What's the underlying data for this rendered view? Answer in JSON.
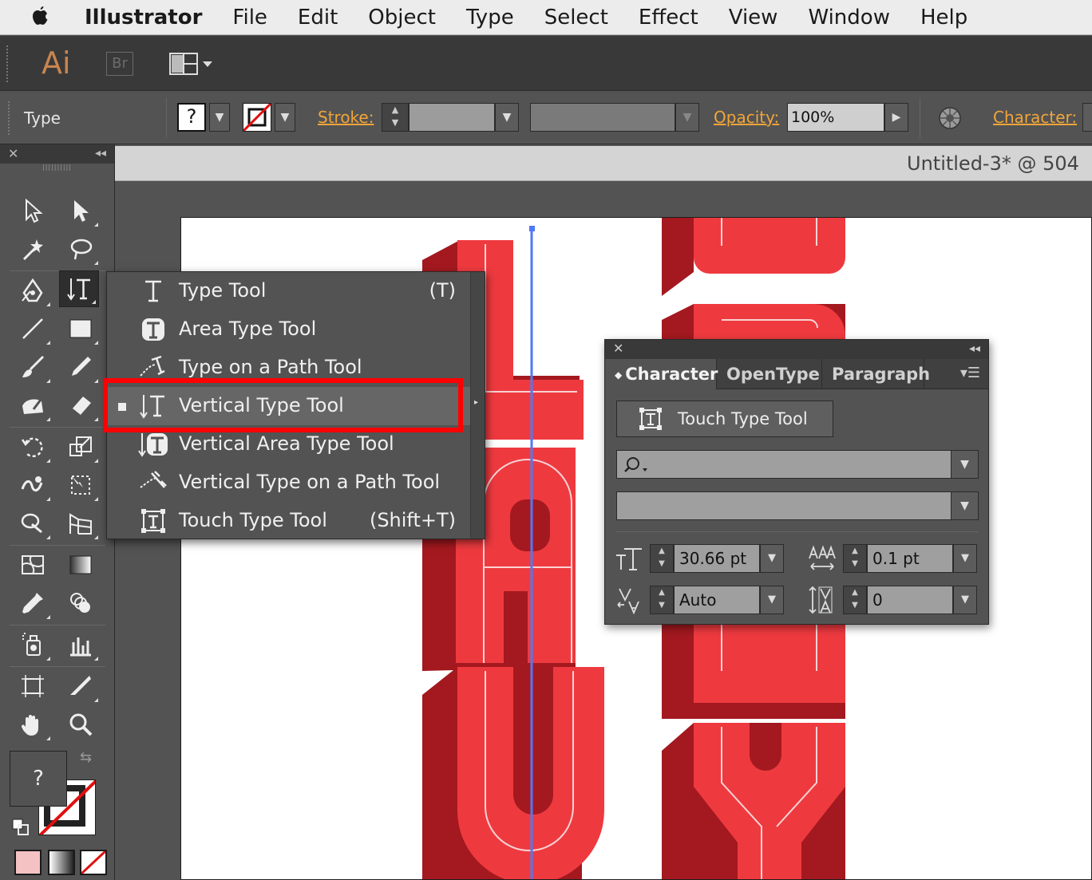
{
  "menubar": {
    "app_name": "Illustrator",
    "items": [
      "File",
      "Edit",
      "Object",
      "Type",
      "Select",
      "Effect",
      "View",
      "Window",
      "Help"
    ]
  },
  "appbar": {
    "logo": "Ai",
    "bridge": "Br"
  },
  "control_bar": {
    "selection_label": "Type",
    "fill_value": "?",
    "stroke_label": "Stroke:",
    "opacity_label": "Opacity:",
    "opacity_value": "100%",
    "character_label": "Character:"
  },
  "document": {
    "tab_title": "Untitled-3* @ 504"
  },
  "toolbox": {
    "fill_value": "?"
  },
  "flyout": {
    "items": [
      {
        "label": "Type Tool",
        "shortcut": "(T)",
        "icon": "type-icon"
      },
      {
        "label": "Area Type Tool",
        "shortcut": "",
        "icon": "area-type-icon"
      },
      {
        "label": "Type on a Path Tool",
        "shortcut": "",
        "icon": "type-path-icon"
      },
      {
        "label": "Vertical Type Tool",
        "shortcut": "",
        "icon": "vertical-type-icon",
        "selected": true
      },
      {
        "label": "Vertical Area Type Tool",
        "shortcut": "",
        "icon": "vertical-area-type-icon"
      },
      {
        "label": "Vertical Type on a Path Tool",
        "shortcut": "",
        "icon": "vertical-type-path-icon"
      },
      {
        "label": "Touch Type Tool",
        "shortcut": "(Shift+T)",
        "icon": "touch-type-icon"
      }
    ]
  },
  "character_panel": {
    "tabs": [
      "Character",
      "OpenType",
      "Paragraph"
    ],
    "touch_button": "Touch Type Tool",
    "font_size": "30.66 pt",
    "leading": "0.1 pt",
    "kerning": "Auto",
    "tracking": "0"
  },
  "colors": {
    "accent": "#f0a53a",
    "highlight": "#ff0000",
    "art_red": "#ee3a3f",
    "art_dark_red": "#a3191f",
    "guide_blue": "#4f79f7"
  }
}
